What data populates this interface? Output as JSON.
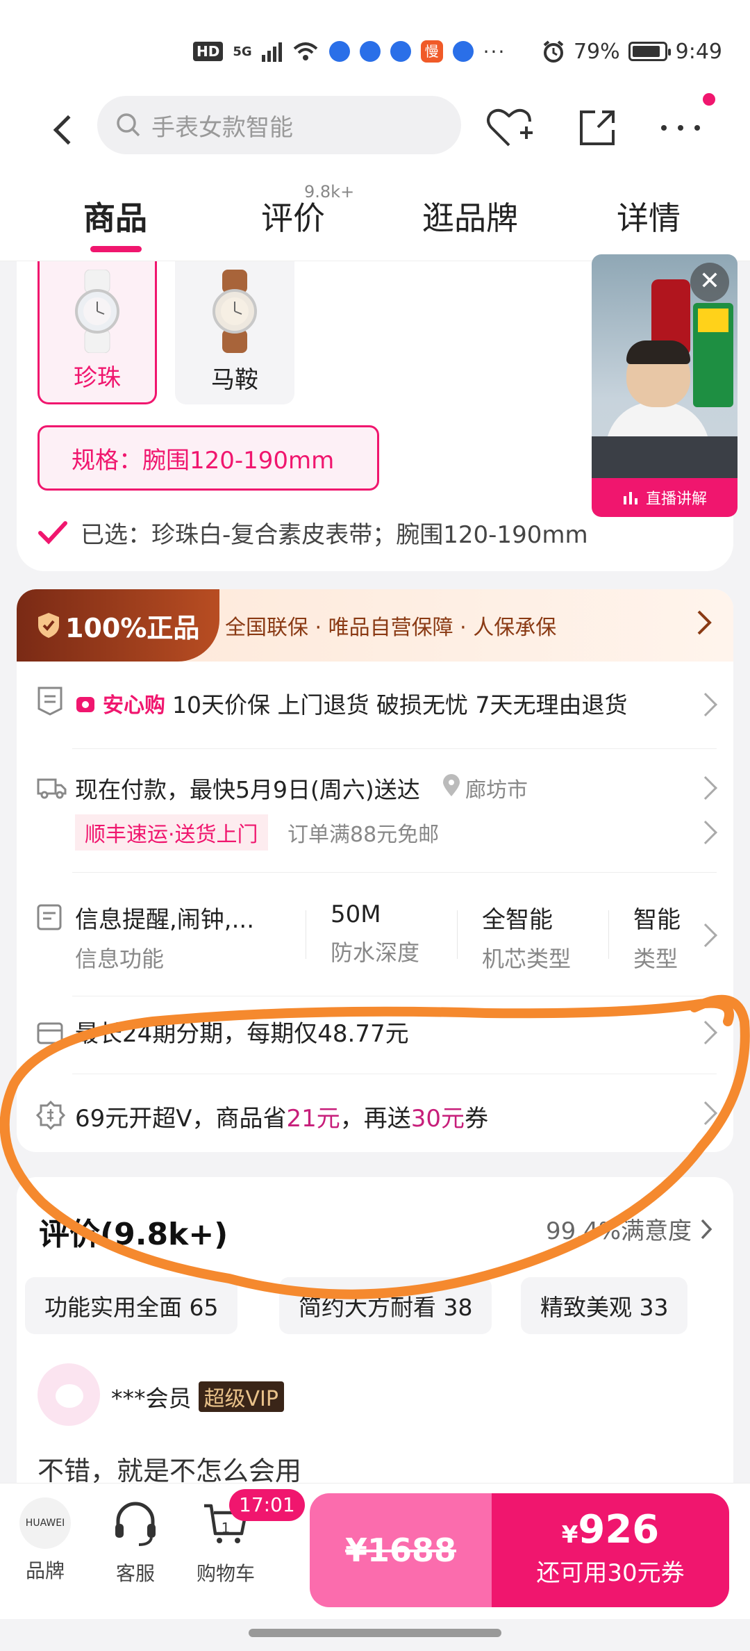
{
  "status_bar": {
    "network": "5G",
    "hd": "HD",
    "app_icon": "慢",
    "more": "···",
    "battery": "79%",
    "time": "9:49"
  },
  "top_nav": {
    "search_placeholder": "手表女款智能",
    "icons": [
      "back-icon",
      "search-icon",
      "heart-plus-icon",
      "share-icon",
      "more-icon"
    ]
  },
  "tabs": [
    {
      "label": "商品",
      "active": true
    },
    {
      "label": "评价",
      "badge": "9.8k+"
    },
    {
      "label": "逛品牌"
    },
    {
      "label": "详情"
    }
  ],
  "spec": {
    "colors": [
      {
        "label": "珍珠",
        "selected": true
      },
      {
        "label": "马鞍",
        "selected": false
      }
    ],
    "size_chip": "规格：腕围120-190mm",
    "selected_text": "已选：珍珠白-复合素皮表带；腕围120-190mm"
  },
  "live": {
    "label": "直播讲解",
    "close": "✕"
  },
  "guarantee": {
    "badge": "100%正品",
    "text": "全国联保 · 唯品自营保障 · 人保承保"
  },
  "service": {
    "anxin_brand": "安心购",
    "anxin_text": "10天价保 上门退货 破损无忧 7天无理由退货"
  },
  "delivery": {
    "line1": "现在付款，最快5月9日(周六)送达",
    "location": "廊坊市",
    "sf_tag": "顺丰速运·送货上门",
    "free_ship": "订单满88元免邮"
  },
  "specs_row": [
    {
      "value": "信息提醒,闹钟,...",
      "key": "信息功能"
    },
    {
      "value": "50M",
      "key": "防水深度"
    },
    {
      "value": "全智能",
      "key": "机芯类型"
    },
    {
      "value": "智能",
      "key": "类型"
    }
  ],
  "installment": {
    "text": "最长24期分期，每期仅48.77元"
  },
  "super_vip": {
    "prefix": "69元开超V，商品省",
    "save": "21元",
    "mid": "，再送",
    "coupon": "30元",
    "suffix": "券"
  },
  "reviews": {
    "title": "评价(9.8k+)",
    "satisfaction": "99.4%满意度",
    "tags": [
      "功能实用全面 65",
      "简约大方耐看 38",
      "精致美观 33"
    ],
    "user": "***会员",
    "vip_badge": "超级VIP",
    "text": "不错，就是不怎么会用"
  },
  "bottom_bar": {
    "brand_logo": "HUAWEI",
    "brand_label": "品牌",
    "service_label": "客服",
    "cart_label": "购物车",
    "cart_count": "1",
    "cart_badge": "17:01",
    "original_price": "¥1688",
    "buy_currency": "¥",
    "buy_price": "926",
    "buy_sub": "还可用30元券"
  },
  "colors": {
    "accent": "#f0166e",
    "annotation": "#f5892e",
    "guarantee_brown": "#8a3a14"
  }
}
